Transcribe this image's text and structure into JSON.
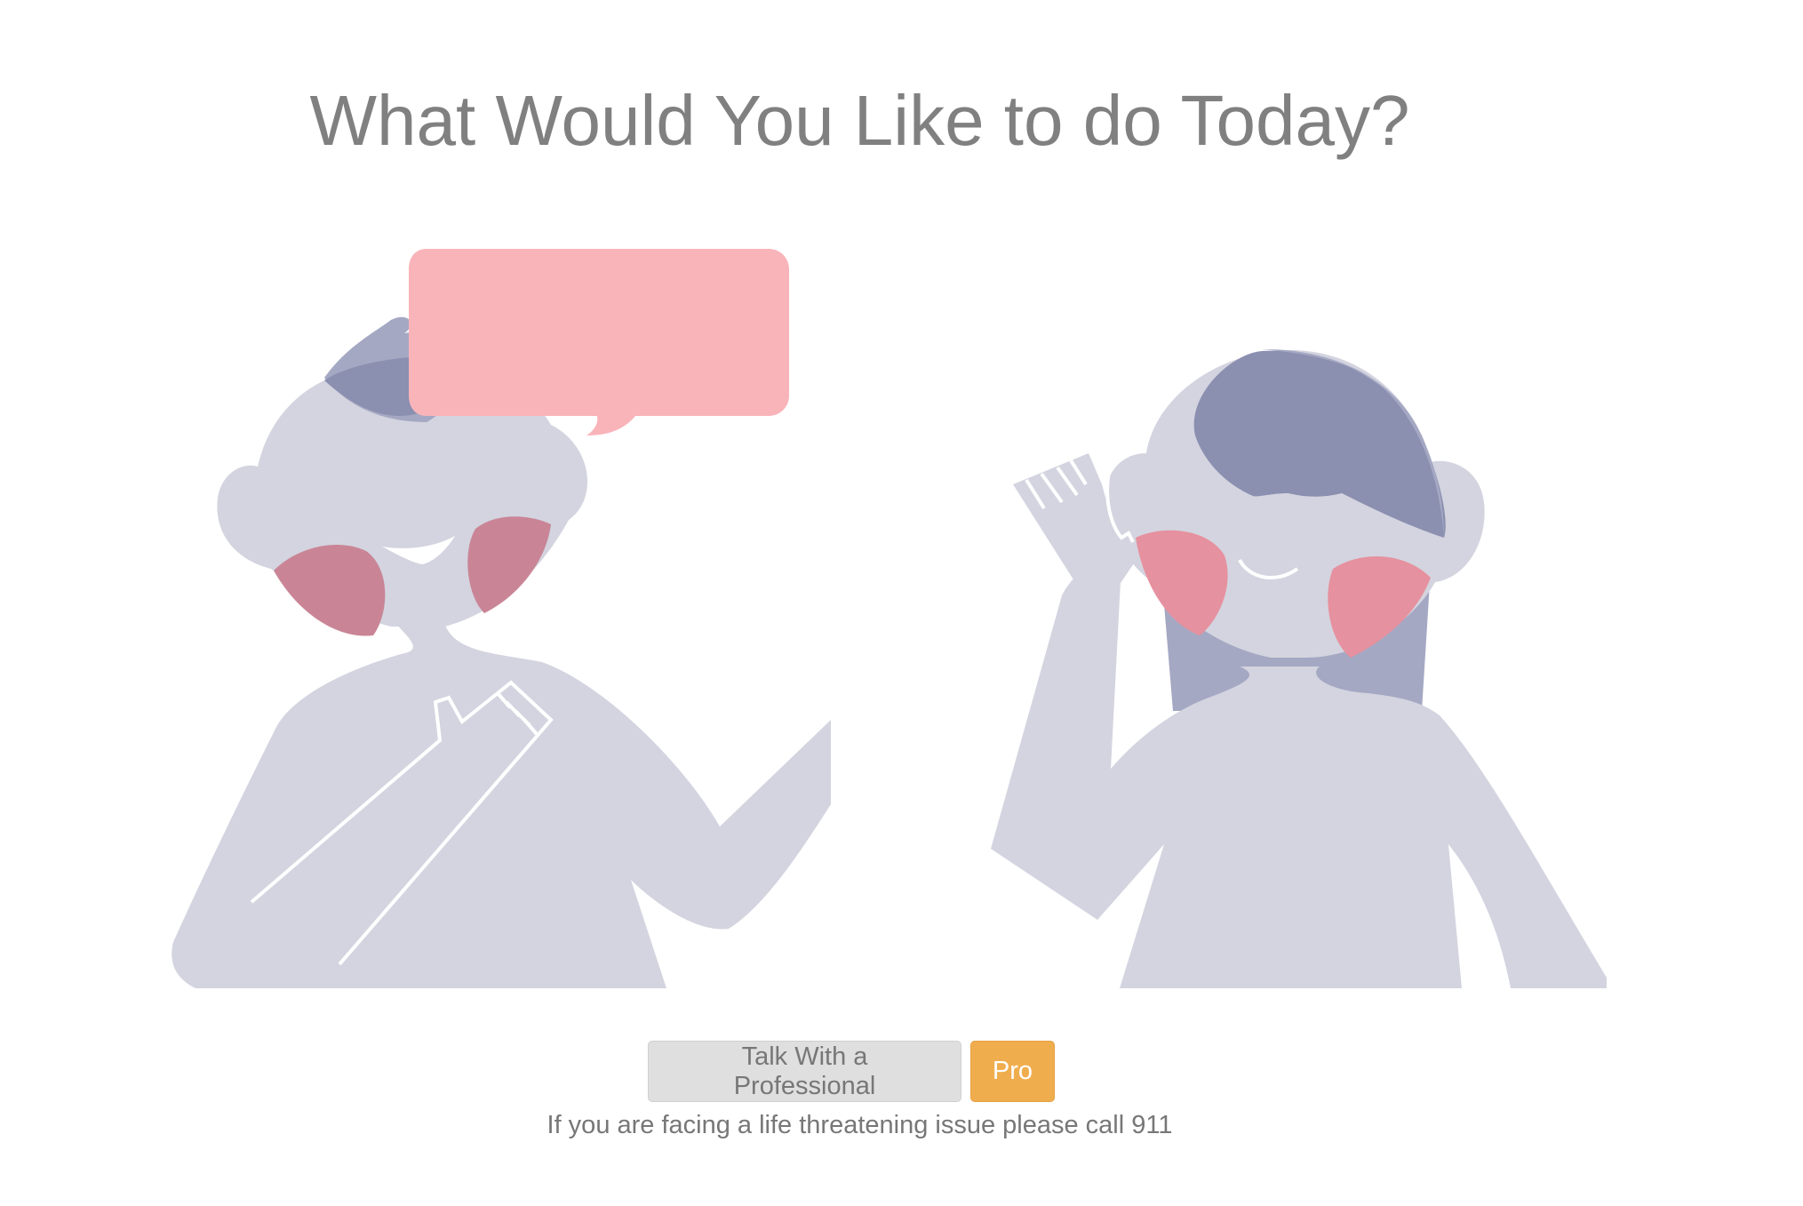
{
  "page": {
    "title": "What Would You Like to do Today?",
    "notice": "If you are facing a life threatening issue please call 911"
  },
  "actions": {
    "talk_label": "Talk With a Professional",
    "pro_label": "Pro"
  },
  "colors": {
    "title_text": "#808080",
    "body_fill": "#d3d4df",
    "hair_dark": "#8b8fb0",
    "hair_light": "#a5a8c3",
    "cheek_left": "#c98596",
    "cheek_right": "#e6919f",
    "speech_bubble": "#f8b4b9",
    "talk_button_bg": "#dfdfdf",
    "pro_button_bg": "#f0ad4e"
  }
}
